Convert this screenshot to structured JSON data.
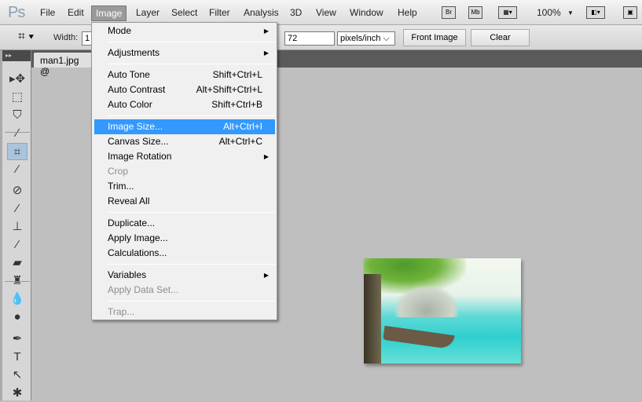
{
  "app": {
    "logo": "Ps"
  },
  "menubar": {
    "items": [
      "File",
      "Edit",
      "Image",
      "Layer",
      "Select",
      "Filter",
      "Analysis",
      "3D",
      "View",
      "Window",
      "Help"
    ],
    "active": "Image",
    "bridge": "Br",
    "mini_bridge": "Mb",
    "zoom": "100%"
  },
  "options": {
    "width_label": "Width:",
    "width_value": "1",
    "resolution_value": "72",
    "resolution_unit": "pixels/inch",
    "front_image": "Front Image",
    "clear": "Clear"
  },
  "document": {
    "tab": "man1.jpg @"
  },
  "image_menu": {
    "items": [
      {
        "label": "Mode",
        "submenu": true
      },
      {
        "sep": true
      },
      {
        "label": "Adjustments",
        "submenu": true
      },
      {
        "sep": true
      },
      {
        "label": "Auto Tone",
        "shortcut": "Shift+Ctrl+L"
      },
      {
        "label": "Auto Contrast",
        "shortcut": "Alt+Shift+Ctrl+L"
      },
      {
        "label": "Auto Color",
        "shortcut": "Shift+Ctrl+B"
      },
      {
        "sep": true
      },
      {
        "label": "Image Size...",
        "shortcut": "Alt+Ctrl+I",
        "highlighted": true
      },
      {
        "label": "Canvas Size...",
        "shortcut": "Alt+Ctrl+C"
      },
      {
        "label": "Image Rotation",
        "submenu": true
      },
      {
        "label": "Crop",
        "disabled": true
      },
      {
        "label": "Trim..."
      },
      {
        "label": "Reveal All"
      },
      {
        "sep": true
      },
      {
        "label": "Duplicate..."
      },
      {
        "label": "Apply Image..."
      },
      {
        "label": "Calculations..."
      },
      {
        "sep": true
      },
      {
        "label": "Variables",
        "submenu": true
      },
      {
        "label": "Apply Data Set...",
        "disabled": true
      },
      {
        "sep": true
      },
      {
        "label": "Trap...",
        "disabled": true
      }
    ]
  },
  "tools": [
    {
      "name": "move",
      "glyph": "▸✥"
    },
    {
      "name": "marquee",
      "glyph": "⬚"
    },
    {
      "name": "lasso",
      "glyph": "⛉"
    },
    {
      "name": "quick-selection",
      "glyph": "⁄"
    },
    {
      "name": "crop",
      "glyph": "⌗",
      "selected": true
    },
    {
      "name": "eyedropper",
      "glyph": "⁄"
    },
    {
      "name": "healing-brush",
      "glyph": "⊘"
    },
    {
      "name": "brush",
      "glyph": "⁄"
    },
    {
      "name": "clone-stamp",
      "glyph": "⊥"
    },
    {
      "name": "history-brush",
      "glyph": "⁄"
    },
    {
      "name": "eraser",
      "glyph": "▰"
    },
    {
      "name": "paint-bucket",
      "glyph": "♜"
    },
    {
      "name": "blur",
      "glyph": "💧"
    },
    {
      "name": "dodge",
      "glyph": "●"
    },
    {
      "name": "pen",
      "glyph": "✒"
    },
    {
      "name": "type",
      "glyph": "T"
    },
    {
      "name": "path-selection",
      "glyph": "↖"
    },
    {
      "name": "custom-shape",
      "glyph": "✱"
    }
  ]
}
